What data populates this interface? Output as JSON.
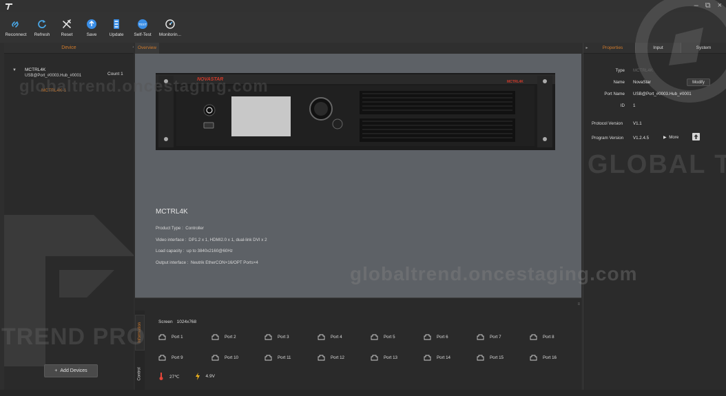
{
  "window": {
    "minimize": "–",
    "maximize": "⧉",
    "close": "×"
  },
  "toolbar": {
    "reconnect": "Reconnect",
    "refresh": "Refresh",
    "reset": "Reset",
    "save": "Save",
    "update": "Update",
    "self_test": "Self-Test",
    "monitoring": "Monitorin..."
  },
  "left": {
    "header": "Device",
    "device_name": "MCTRL4K",
    "device_port": "USB@Port_#0003.Hub_#0001",
    "count": "Count 1",
    "child": "MCTRL4K-1",
    "add_devices": "Add Devices"
  },
  "center": {
    "tab": "Overview",
    "brand": "NOVASTAR",
    "device_label": "MCTRL4K",
    "device_title": "MCTRL4K",
    "product_type": "Product Type :  Controller",
    "video_interface": "Video interface :  DP1.2 x 1, HDMI2.0 x 1, dual-link DVI x 2",
    "load_capacity": "Load capacity :  up to 3840x2160@60Hz",
    "output_interface": "Output interface :  Neutrik EtherCON×16/OPT Ports×4"
  },
  "bottom": {
    "tab_information": "Information",
    "tab_control": "Control",
    "screen_label": "Screen",
    "screen_value": "1024x768",
    "ports": [
      "Port 1",
      "Port 2",
      "Port 3",
      "Port 4",
      "Port 5",
      "Port 6",
      "Port 7",
      "Port 8",
      "Port 9",
      "Port 10",
      "Port 11",
      "Port 12",
      "Port 13",
      "Port 14",
      "Port 15",
      "Port 16"
    ],
    "temperature": "27℃",
    "voltage": "4.9V"
  },
  "right": {
    "tabs": [
      "Properties",
      "Input",
      "System"
    ],
    "type_label": "Type",
    "type_value": "MCTRL4K",
    "name_label": "Name",
    "name_value": "NovaStar",
    "modify": "Modify",
    "port_name_label": "Port Name",
    "port_name_value": "USB@Port_#0003.Hub_#0001",
    "id_label": "ID",
    "id_value": "1",
    "protocol_label": "Protocol Version",
    "protocol_value": "V1.1",
    "program_label": "Program Version",
    "program_value": "V1.2.4.5",
    "more": "More"
  },
  "watermarks": {
    "url_top": "globaltrend.oncestaging.com",
    "url_bottom": "globaltrend.oncestaging.com",
    "global": "GLOBAL T",
    "trend": "TREND PRO"
  },
  "colors": {
    "accent": "#d07a2b",
    "panel": "#2a2a2a",
    "overview_bg": "#5d6166"
  }
}
